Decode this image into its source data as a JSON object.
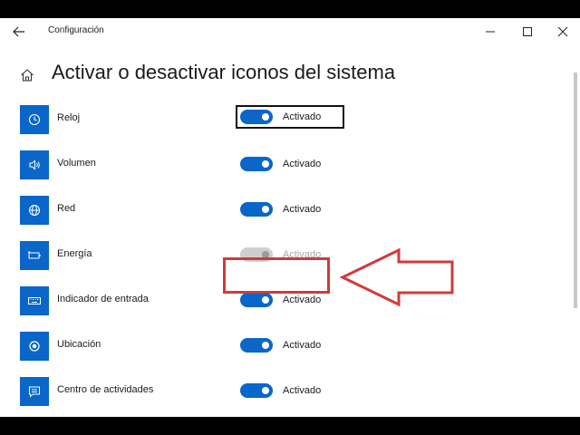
{
  "window": {
    "app_title": "Configuración",
    "page_title": "Activar o desactivar iconos del sistema"
  },
  "colors": {
    "accent": "#0a66c8",
    "highlight": "#d23a3a",
    "disabled": "#cfcfcf"
  },
  "items": [
    {
      "label": "Reloj",
      "icon": "clock-icon",
      "state": "Activado",
      "on": true,
      "enabled": true,
      "focused": true
    },
    {
      "label": "Volumen",
      "icon": "volume-icon",
      "state": "Activado",
      "on": true,
      "enabled": true,
      "focused": false
    },
    {
      "label": "Red",
      "icon": "globe-icon",
      "state": "Activado",
      "on": true,
      "enabled": true,
      "focused": false
    },
    {
      "label": "Energía",
      "icon": "battery-icon",
      "state": "Activado",
      "on": true,
      "enabled": false,
      "focused": false
    },
    {
      "label": "Indicador de entrada",
      "icon": "keyboard-icon",
      "state": "Activado",
      "on": true,
      "enabled": true,
      "focused": false
    },
    {
      "label": "Ubicación",
      "icon": "location-icon",
      "state": "Activado",
      "on": true,
      "enabled": true,
      "focused": false
    },
    {
      "label": "Centro de actividades",
      "icon": "action-center-icon",
      "state": "Activado",
      "on": true,
      "enabled": true,
      "focused": false
    }
  ]
}
